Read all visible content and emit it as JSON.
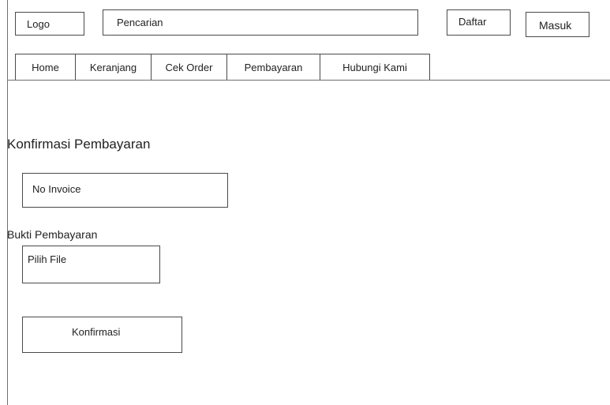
{
  "header": {
    "logo_label": "Logo",
    "search_placeholder": "Pencarian",
    "daftar_label": "Daftar",
    "masuk_label": "Masuk"
  },
  "nav": {
    "items": [
      {
        "label": "Home"
      },
      {
        "label": "Keranjang"
      },
      {
        "label": "Cek Order"
      },
      {
        "label": "Pembayaran"
      },
      {
        "label": "Hubungi Kami"
      }
    ]
  },
  "main": {
    "title": "Konfirmasi Pembayaran",
    "invoice_placeholder": "No Invoice",
    "bukti_label": "Bukti Pembayaran",
    "file_button_label": "Pilih File",
    "confirm_button_label": "Konfirmasi"
  }
}
